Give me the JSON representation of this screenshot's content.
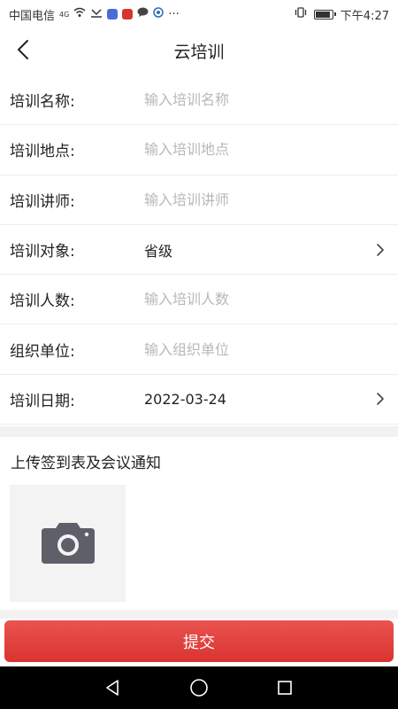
{
  "status_bar": {
    "carrier": "中国电信",
    "network": "4G",
    "time": "下午4:27",
    "dots": "···",
    "battery_level": 0.9
  },
  "header": {
    "title": "云培训",
    "back_icon": "chevron-left-icon"
  },
  "form": {
    "rows": [
      {
        "label": "培训名称:",
        "placeholder": "输入培训名称",
        "value": ""
      },
      {
        "label": "培训地点:",
        "placeholder": "输入培训地点",
        "value": ""
      },
      {
        "label": "培训讲师:",
        "placeholder": "输入培训讲师",
        "value": ""
      },
      {
        "label": "培训对象:",
        "value": "省级",
        "type": "select"
      },
      {
        "label": "培训人数:",
        "placeholder": "输入培训人数",
        "value": ""
      },
      {
        "label": "组织单位:",
        "placeholder": "输入组织单位",
        "value": ""
      },
      {
        "label": "培训日期:",
        "value": "2022-03-24",
        "type": "select"
      }
    ]
  },
  "upload": {
    "title": "上传签到表及会议通知",
    "icon": "camera-icon"
  },
  "submit": {
    "label": "提交",
    "color": "#e0413d"
  },
  "nav_bar": {
    "icons": [
      "back-triangle-icon",
      "home-circle-icon",
      "recents-square-icon"
    ]
  }
}
